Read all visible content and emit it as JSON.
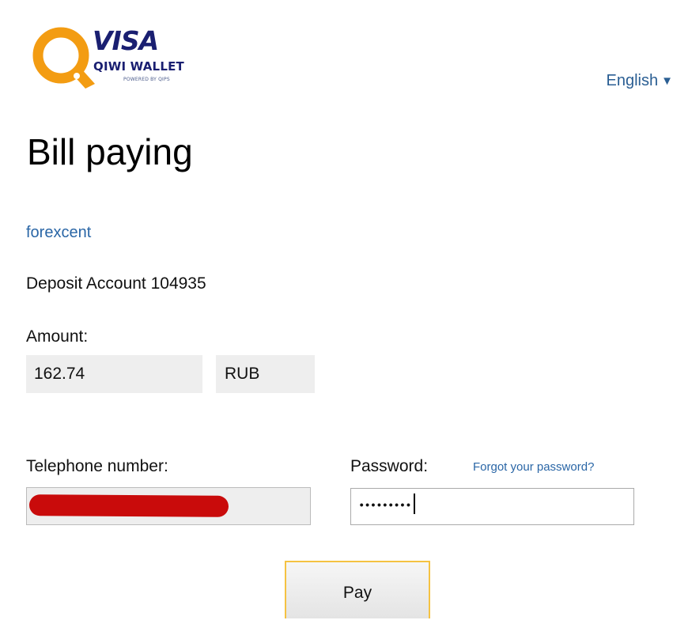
{
  "header": {
    "logo": {
      "brand": "VISA",
      "product": "QIWI WALLET",
      "powered_by": "POWERED BY QIPS",
      "colors": {
        "ring": "#f39c12",
        "text": "#1a1f71"
      }
    },
    "language": {
      "selected": "English",
      "icon": "caret-down-icon",
      "arrow": "▼"
    }
  },
  "page": {
    "title": "Bill paying",
    "merchant_link": "forexcent",
    "description": "Deposit Account 104935"
  },
  "payment": {
    "amount_label": "Amount:",
    "amount_value": "162.74",
    "currency": "RUB"
  },
  "login": {
    "telephone_label": "Telephone number:",
    "telephone_value_redacted": true,
    "password_label": "Password:",
    "forgot_password_link": "Forgot your password?",
    "password_masked": "•••••••••"
  },
  "actions": {
    "pay_label": "Pay"
  },
  "colors": {
    "link": "#2a66a6",
    "input_bg": "#eeeeee",
    "pay_border": "#f5c242",
    "redaction": "#c90b0b"
  }
}
